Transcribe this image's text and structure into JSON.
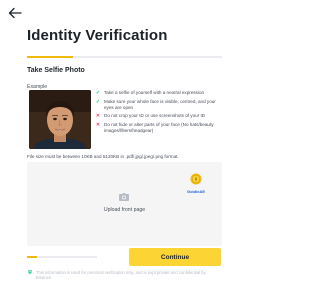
{
  "header": {
    "title": "Identity Verification"
  },
  "progress": {
    "step_fraction": 0.21
  },
  "section": {
    "subtitle": "Take Selfie Photo",
    "example_label": "Example"
  },
  "guidelines": [
    {
      "type": "do",
      "icon": "check-icon",
      "text": "Take a selfie of yourself with a neutral expression"
    },
    {
      "type": "do",
      "icon": "check-icon",
      "text": "Make sure your whole face is visible, centred, and your eyes are open"
    },
    {
      "type": "dont",
      "icon": "cross-icon",
      "text": "Do not crop your ID or use screenshots of your ID"
    },
    {
      "type": "dont",
      "icon": "cross-icon",
      "text": "Do not hide or alter parts of your face (No hats/beauty images/filters/headgear)"
    }
  ],
  "file_note": "File size must be between 10KB and 5120KB in .pdf/.jpg/.jpeg/.png format.",
  "upload": {
    "label": "Upload front page",
    "icon": "camera-icon"
  },
  "badge": {
    "text": "GoldleAE",
    "icon": "coin-logo-icon"
  },
  "upload_progress": {
    "fraction": 0.14
  },
  "continue_button": {
    "label": "Continue"
  },
  "privacy_note": "This information is used for personal verification only, and is kept private and confidential by Binance.",
  "colors": {
    "accent": "#FCD535",
    "step": "#F0B90B",
    "ok": "#0ECB81",
    "bad": "#F6465D"
  }
}
